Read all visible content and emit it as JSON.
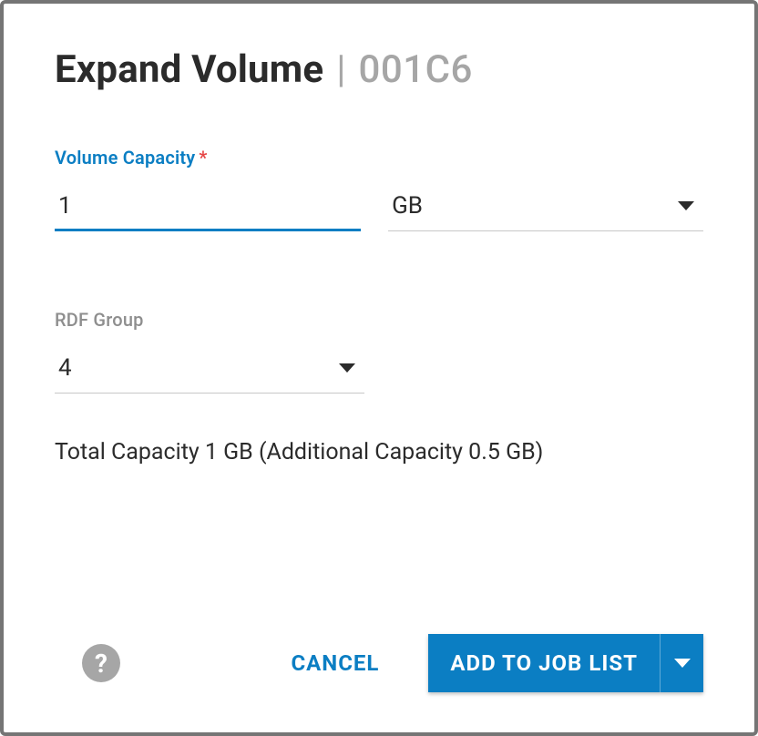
{
  "header": {
    "title": "Expand Volume",
    "divider": "|",
    "volume_id": "001C6"
  },
  "fields": {
    "capacity": {
      "label": "Volume Capacity",
      "required_mark": "*",
      "value": "1"
    },
    "unit": {
      "value": "GB"
    },
    "rdf_group": {
      "label": "RDF Group",
      "value": "4"
    }
  },
  "summary": "Total Capacity 1 GB (Additional Capacity 0.5 GB)",
  "footer": {
    "help_glyph": "?",
    "cancel": "CANCEL",
    "primary": "ADD TO JOB LIST"
  }
}
